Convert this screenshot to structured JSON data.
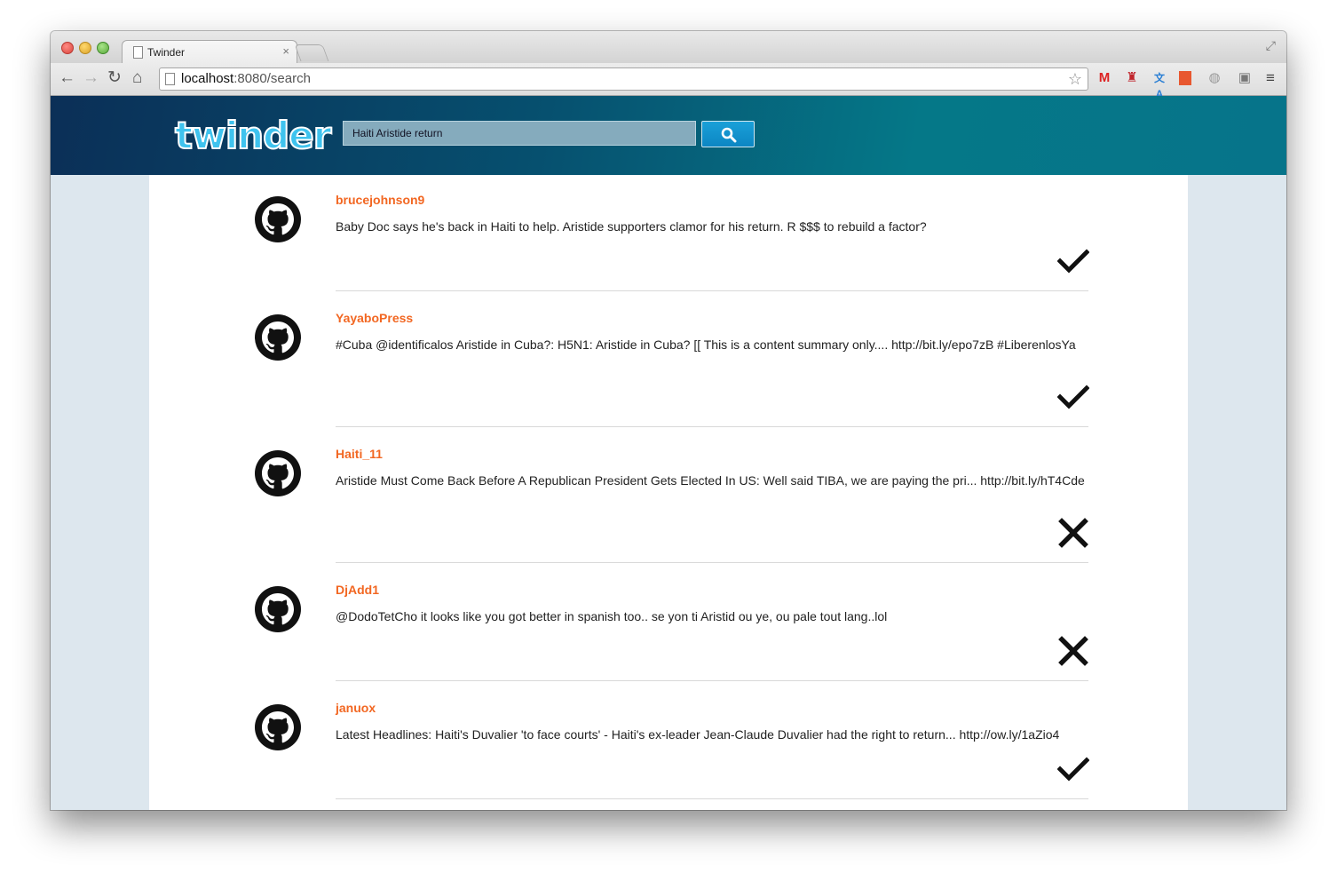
{
  "browser": {
    "tab_title": "Twinder",
    "tab_close": "×",
    "url_host": "localhost",
    "url_rest": ":8080/search",
    "nav": {
      "back": "←",
      "forward": "→",
      "reload": "↻",
      "home": "⌂"
    },
    "extensions": [
      "gmail-icon",
      "couch-icon",
      "translate-icon",
      "bookmark-icon",
      "dictionary-icon",
      "screen-icon",
      "menu-icon"
    ]
  },
  "header": {
    "logo": "twinder",
    "search_value": "Haiti Aristide return"
  },
  "tweets": [
    {
      "user": "brucejohnson9",
      "text": "Baby Doc says he's back in Haiti to help. Aristide supporters clamor for his return. R $$$ to rebuild a factor?",
      "verdict": "check"
    },
    {
      "user": "YayaboPress",
      "text": "#Cuba @identificalos Aristide in Cuba?: H5N1: Aristide in Cuba? [[ This is a content summary only.... http://bit.ly/epo7zB #LiberenlosYa",
      "verdict": "check"
    },
    {
      "user": "Haiti_11",
      "text": "Aristide Must Come Back Before A Republican President Gets Elected In US: Well said TIBA, we are paying the pri... http://bit.ly/hT4Cde",
      "verdict": "cross"
    },
    {
      "user": "DjAdd1",
      "text": "@DodoTetCho it looks like you got better in spanish too.. se yon ti Aristid ou ye, ou pale tout lang..lol",
      "verdict": "cross"
    },
    {
      "user": "januox",
      "text": "Latest Headlines: Haiti's Duvalier 'to face courts' - Haiti's ex-leader Jean-Claude Duvalier had the right to return... http://ow.ly/1aZio4",
      "verdict": "check"
    }
  ]
}
